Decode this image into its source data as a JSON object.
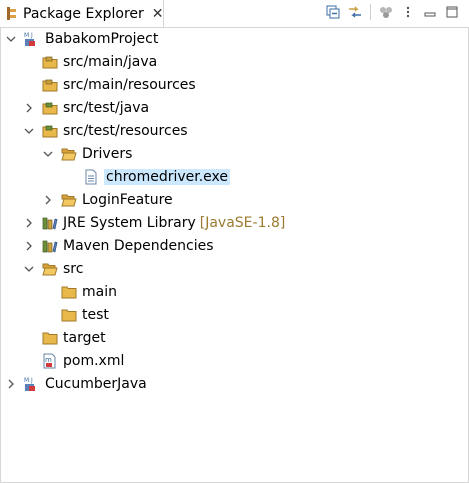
{
  "view": {
    "title": "Package Explorer",
    "close_icon": "close-icon",
    "icon": "package-explorer-icon"
  },
  "toolbar": {
    "buttons": [
      "collapse-all-icon",
      "link-with-editor-icon",
      "focus-on-active-task-icon",
      "view-menu-icon",
      "minimize-icon",
      "maximize-icon"
    ]
  },
  "tree": {
    "babakom": "BabakomProject",
    "src_main_java": "src/main/java",
    "src_main_resources": "src/main/resources",
    "src_test_java": "src/test/java",
    "src_test_resources": "src/test/resources",
    "drivers": "Drivers",
    "chromedriver": "chromedriver.exe",
    "loginfeature": "LoginFeature",
    "jre": "JRE System Library",
    "jre_decoration": "[JavaSE-1.8]",
    "maven": "Maven Dependencies",
    "src": "src",
    "main": "main",
    "test": "test",
    "target": "target",
    "pom": "pom.xml",
    "cucumber": "CucumberJava"
  },
  "colors": {
    "selection": "#cce8ff",
    "folder": "#e9b84a",
    "package": "#c8a040",
    "decoration": "#9a7b2f"
  }
}
